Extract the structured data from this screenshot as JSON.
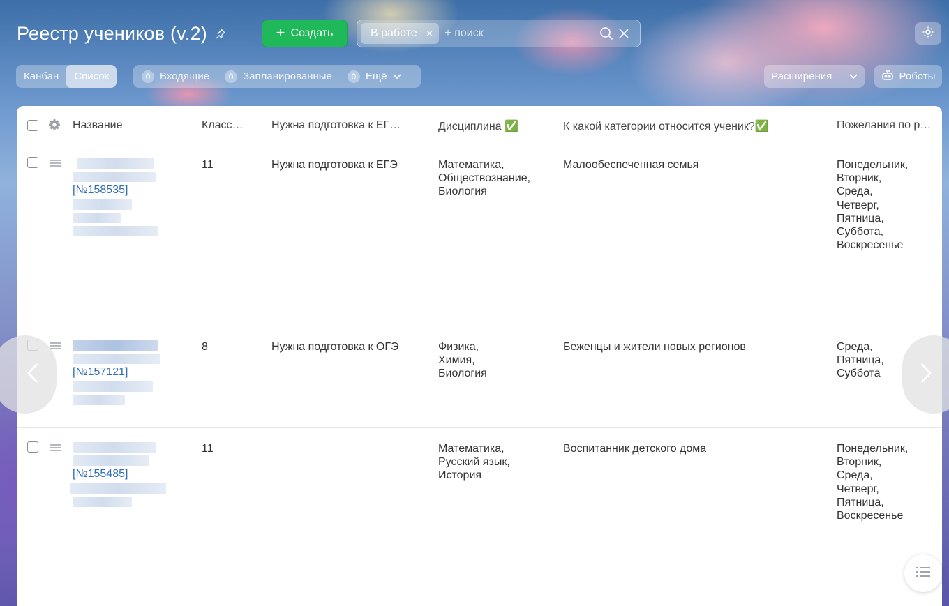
{
  "header": {
    "title": "Реестр учеников (v.2)",
    "create_label": "Создать",
    "filter_chip": "В работе",
    "search_placeholder": "+ поиск"
  },
  "toolbar": {
    "views": [
      "Канбан",
      "Список"
    ],
    "active_view": "Список",
    "counters": [
      {
        "count": "0",
        "label": "Входящие"
      },
      {
        "count": "0",
        "label": "Запланированные"
      },
      {
        "count": "0",
        "label": "Ещё"
      }
    ],
    "extensions_label": "Расширения",
    "robots_label": "Роботы"
  },
  "table": {
    "columns": [
      "Название",
      "Класс…",
      "Нужна подготовка к ЕГ…",
      "Дисциплина ✅",
      "К какой категории относится ученик?✅",
      "Пожелания по р…"
    ],
    "rows": [
      {
        "id": "[№158535]",
        "grade": "11",
        "prep": "Нужна подготовка к ЕГЭ",
        "disciplines": [
          "Математика,",
          "Обществознание,",
          "Биология"
        ],
        "category": "Малообеспеченная семья",
        "days": [
          "Понедельник,",
          "Вторник,",
          "Среда,",
          "Четверг,",
          "Пятница,",
          "Суббота,",
          "Воскресенье"
        ]
      },
      {
        "id": "[№157121]",
        "grade": "8",
        "prep": "Нужна подготовка к ОГЭ",
        "disciplines": [
          "Физика,",
          "Химия,",
          "Биология"
        ],
        "category": "Беженцы и жители новых регионов",
        "days": [
          "Среда,",
          "Пятница,",
          "Суббота"
        ]
      },
      {
        "id": "[№155485]",
        "grade": "11",
        "prep": "",
        "disciplines": [
          "Математика,",
          "Русский язык,",
          "История"
        ],
        "category": "Воспитанник детского дома",
        "days": [
          "Понедельник,",
          "Вторник,",
          "Среда,",
          "Четверг,",
          "Пятница,",
          "Воскресенье"
        ]
      }
    ]
  },
  "colors": {
    "create_button": "#1fb95a",
    "link": "#2f6fb2"
  }
}
